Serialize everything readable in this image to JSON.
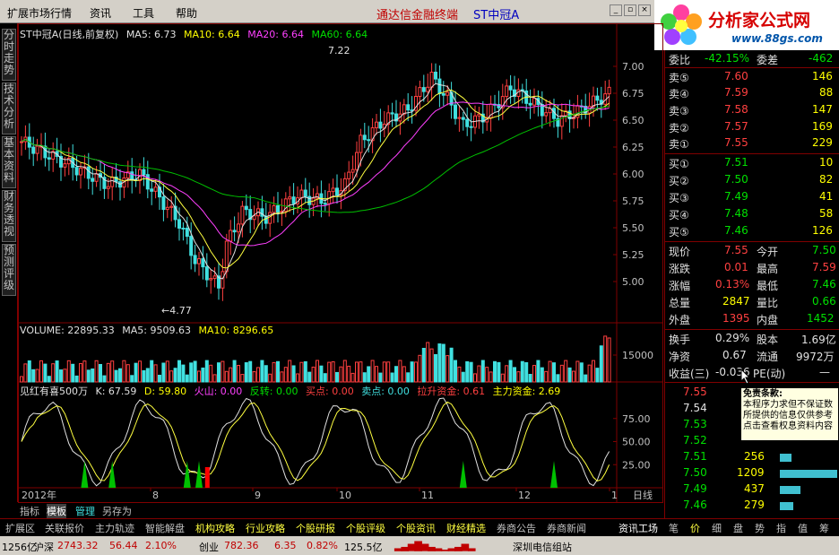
{
  "menu": {
    "items": [
      "扩展市场行情",
      "资讯",
      "工具",
      "帮助"
    ],
    "app_title": "通达信金融终端",
    "stock_name": "ST中冠A"
  },
  "logo": {
    "title": "分析家公式网",
    "url": "www.88gs.com"
  },
  "side_tabs": [
    "分时走势",
    "技术分析",
    "基本资料",
    "财务透视",
    "预测评级"
  ],
  "kline_header": {
    "name": "ST中冠A(日线,前复权)",
    "ma5": "MA5: 6.73",
    "ma10": "MA10: 6.64",
    "ma20": "MA20: 6.64",
    "ma60": "MA60: 6.64"
  },
  "price_axis": [
    "7.00",
    "6.75",
    "6.50",
    "6.25",
    "6.00",
    "5.75",
    "5.50",
    "5.25",
    "5.00"
  ],
  "price_marks": {
    "high": "7.22",
    "low": "4.77"
  },
  "volume_header": {
    "volume": "VOLUME: 22895.33",
    "ma5": "MA5: 9509.63",
    "ma10": "MA10: 8296.65"
  },
  "volume_axis": [
    "15000"
  ],
  "indicator_header": {
    "name": "见红有喜500万",
    "k": "K: 67.59",
    "d": "D: 59.80",
    "fire": "火山: 0.00",
    "reverse": "反转: 0.00",
    "buy": "买点: 0.00",
    "sell": "卖点: 0.00",
    "pull": "拉升资金: 0.61",
    "main": "主力资金: 2.69"
  },
  "indicator_axis": [
    "75.00",
    "50.00",
    "25.00"
  ],
  "date_axis": {
    "year": "2012年",
    "months": [
      "8",
      "9",
      "10",
      "11",
      "12",
      "1"
    ],
    "period": "日线"
  },
  "bottom_tabs": [
    "指标",
    "模板",
    "管理",
    "另存为"
  ],
  "nav_tabs": [
    "扩展区",
    "关联报价",
    "主力轨迹",
    "智能解盘",
    "机构攻略",
    "行业攻略",
    "个股研报",
    "个股评级",
    "个股资讯",
    "财经精选",
    "券商公告",
    "券商新闻",
    "资讯工场"
  ],
  "right_tabs": [
    "笔",
    "价",
    "细",
    "盘",
    "势",
    "指",
    "值",
    "筹"
  ],
  "quote": {
    "weibi_label": "委比",
    "weibi": "-42.15%",
    "weicha_label": "委差",
    "weicha": "-462",
    "asks": [
      {
        "label": "卖⑤",
        "price": "7.60",
        "vol": "146"
      },
      {
        "label": "卖④",
        "price": "7.59",
        "vol": "88"
      },
      {
        "label": "卖③",
        "price": "7.58",
        "vol": "147"
      },
      {
        "label": "卖②",
        "price": "7.57",
        "vol": "169"
      },
      {
        "label": "卖①",
        "price": "7.55",
        "vol": "229"
      }
    ],
    "bids": [
      {
        "label": "买①",
        "price": "7.51",
        "vol": "10"
      },
      {
        "label": "买②",
        "price": "7.50",
        "vol": "82"
      },
      {
        "label": "买③",
        "price": "7.49",
        "vol": "41"
      },
      {
        "label": "买④",
        "price": "7.48",
        "vol": "58"
      },
      {
        "label": "买⑤",
        "price": "7.46",
        "vol": "126"
      }
    ],
    "stats": [
      {
        "l1": "现价",
        "v1": "7.55",
        "l2": "今开",
        "v2": "7.50"
      },
      {
        "l1": "涨跌",
        "v1": "0.01",
        "l2": "最高",
        "v2": "7.59"
      },
      {
        "l1": "涨幅",
        "v1": "0.13%",
        "l2": "最低",
        "v2": "7.46"
      },
      {
        "l1": "总量",
        "v1": "2847",
        "l2": "量比",
        "v2": "0.66"
      },
      {
        "l1": "外盘",
        "v1": "1395",
        "l2": "内盘",
        "v2": "1452"
      }
    ],
    "stats2": [
      {
        "l1": "换手",
        "v1": "0.29%",
        "l2": "股本",
        "v2": "1.69亿"
      },
      {
        "l1": "净资",
        "v1": "0.67",
        "l2": "流通",
        "v2": "9972万"
      },
      {
        "l1": "收益(三)",
        "v1": "-0.036",
        "l2": "PE(动)",
        "v2": "—"
      }
    ],
    "ticks": [
      {
        "price": "7.55",
        "vol": "",
        "bar": 0
      },
      {
        "price": "7.54",
        "vol": "",
        "bar": 0
      },
      {
        "price": "7.53",
        "vol": "",
        "bar": 0
      },
      {
        "price": "7.52",
        "vol": "",
        "bar": 0
      },
      {
        "price": "7.51",
        "vol": "256",
        "bar": 0.2
      },
      {
        "price": "7.50",
        "vol": "1209",
        "bar": 1
      },
      {
        "price": "7.49",
        "vol": "437",
        "bar": 0.36
      },
      {
        "price": "7.46",
        "vol": "279",
        "bar": 0.23
      }
    ]
  },
  "disclaimer": {
    "title": "免责条款:",
    "lines": [
      "本程序力求但不保证数",
      "所提供的信息仅供参考",
      "点击查看权息资料内容"
    ]
  },
  "status": {
    "left": "1256亿",
    "index_name": "沪深",
    "index_val": "2743.32",
    "index_chg": "56.44",
    "index_pct": "2.10%",
    "b2_name": "创业",
    "b2_val": "782.36",
    "b2_chg": "6.35",
    "b2_pct": "0.82%",
    "b2_amt": "125.5亿",
    "server": "深圳电信组站"
  }
}
